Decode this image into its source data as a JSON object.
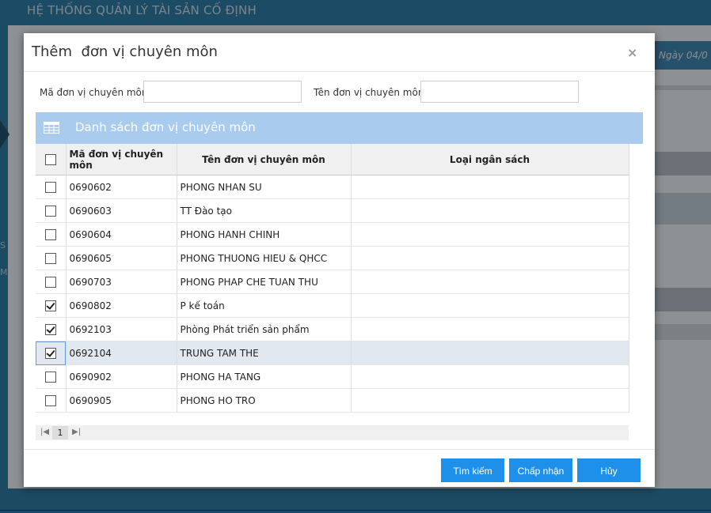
{
  "app": {
    "title": "HỆ THỐNG QUẢN LÝ TÀI SẢN CỐ ĐỊNH",
    "date_fragment": "Ngày 04/0",
    "left_letters": [
      "S",
      "M"
    ]
  },
  "modal": {
    "title": "Thêm  đơn vị chuyên môn",
    "close_symbol": "×"
  },
  "search": {
    "code_label": "Mã đơn vị chuyên môn",
    "code_value": "",
    "name_label": "Tên đơn vị chuyên môn",
    "name_value": ""
  },
  "section": {
    "title": "Danh sách đơn vị chuyên môn",
    "icon": "table-grid-icon"
  },
  "grid": {
    "headers": {
      "code": "Mã đơn vị chuyên môn",
      "name": "Tên đơn vị chuyên môn",
      "budget": "Loại ngân sách"
    },
    "rows": [
      {
        "code": "0690602",
        "name": "PHONG NHAN SU",
        "budget": "",
        "checked": false,
        "selected": false
      },
      {
        "code": "0690603",
        "name": "TT Đào tạo",
        "budget": "",
        "checked": false,
        "selected": false
      },
      {
        "code": "0690604",
        "name": "PHONG HANH CHINH",
        "budget": "",
        "checked": false,
        "selected": false
      },
      {
        "code": "0690605",
        "name": "PHONG THUONG HIEU & QHCC",
        "budget": "",
        "checked": false,
        "selected": false
      },
      {
        "code": "0690703",
        "name": "PHONG PHAP CHE TUAN THU",
        "budget": "",
        "checked": false,
        "selected": false
      },
      {
        "code": "0690802",
        "name": "P kế toán",
        "budget": "",
        "checked": true,
        "selected": false
      },
      {
        "code": "0692103",
        "name": "Phòng Phát triển sản phẩm",
        "budget": "",
        "checked": true,
        "selected": false
      },
      {
        "code": "0692104",
        "name": "TRUNG TAM THE",
        "budget": "",
        "checked": true,
        "selected": true
      },
      {
        "code": "0690902",
        "name": "PHONG HA TANG",
        "budget": "",
        "checked": false,
        "selected": false
      },
      {
        "code": "0690905",
        "name": "PHONG HO TRO",
        "budget": "",
        "checked": false,
        "selected": false
      }
    ]
  },
  "pager": {
    "first_symbol": "⏮",
    "current_page": "1",
    "last_symbol": "⏭"
  },
  "buttons": {
    "search": "Tìm kiếm",
    "accept": "Chấp nhận",
    "cancel": "Hủy"
  },
  "colors": {
    "primary_button": "#1e90ea",
    "section_bar": "#a9cbee",
    "app_header": "#1a6fa0"
  }
}
